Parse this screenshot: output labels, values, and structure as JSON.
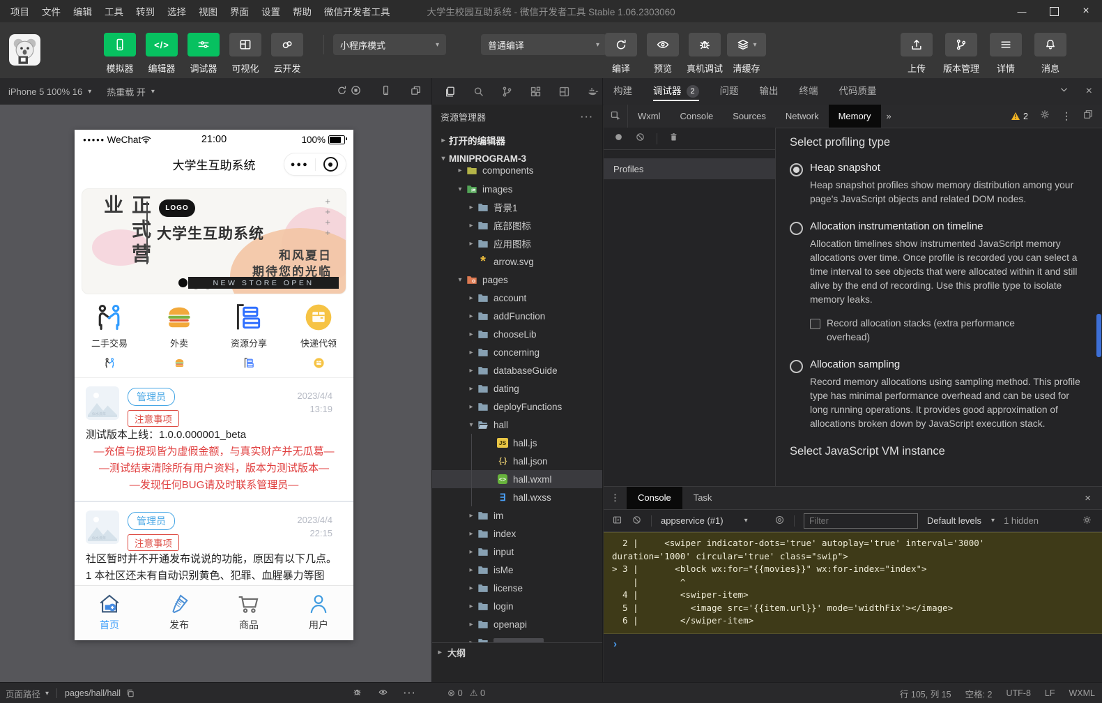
{
  "titlebar": {
    "menus": [
      "项目",
      "文件",
      "编辑",
      "工具",
      "转到",
      "选择",
      "视图",
      "界面",
      "设置",
      "帮助",
      "微信开发者工具"
    ],
    "title": "大学生校园互助系统 - 微信开发者工具 Stable 1.06.2303060"
  },
  "toolbar": {
    "modes": [
      {
        "label": "模拟器",
        "icon": "simulator",
        "active": true
      },
      {
        "label": "编辑器",
        "icon": "editor",
        "active": true
      },
      {
        "label": "调试器",
        "icon": "debug-sliders",
        "active": true
      },
      {
        "label": "可视化",
        "icon": "visual-layout",
        "active": false
      },
      {
        "label": "云开发",
        "icon": "cloud-dev",
        "active": false
      }
    ],
    "mode_select": "小程序模式",
    "compile_select": "普通编译",
    "compile_actions": [
      {
        "label": "编译",
        "icon": "compile-refresh"
      },
      {
        "label": "预览",
        "icon": "preview-eye"
      },
      {
        "label": "真机调试",
        "icon": "device-bug"
      },
      {
        "label": "清缓存",
        "icon": "cache-layers",
        "dropdown": true
      }
    ],
    "right_actions": [
      {
        "label": "上传",
        "icon": "upload"
      },
      {
        "label": "版本管理",
        "icon": "version-branch"
      },
      {
        "label": "详情",
        "icon": "details-list"
      },
      {
        "label": "消息",
        "icon": "message-bell"
      }
    ]
  },
  "simulator": {
    "device_select": "iPhone 5 100% 16",
    "hot_reload": "热重载 开",
    "status": {
      "carrier": "WeChat",
      "time": "21:00",
      "battery": "100%"
    },
    "nav_title": "大学生互助系统",
    "banner": {
      "vertical_title": "正式营业",
      "logo": "LOGO",
      "title": "大学生互助系统",
      "pluses": "+\n+\n+\n+",
      "subtitle1": "和风夏日",
      "subtitle2": "期待您的光临",
      "ribbon": "NEW STORE OPEN"
    },
    "grid": [
      {
        "label": "二手交易",
        "icon": "trade"
      },
      {
        "label": "外卖",
        "icon": "burger"
      },
      {
        "label": "资源分享",
        "icon": "books"
      },
      {
        "label": "快递代领",
        "icon": "parcel"
      }
    ],
    "cards": [
      {
        "badge1": "管理员",
        "badge2": "注意事项",
        "date": "2023/4/4",
        "time": "13:19",
        "lines": [
          {
            "t": "测试版本上线：1.0.0.000001_beta",
            "c": "d",
            "a": "l"
          },
          {
            "t": "—充值与提现皆为虚假金额，与真实财产并无瓜葛—",
            "c": "r",
            "a": "c"
          },
          {
            "t": "—测试结束清除所有用户资料，版本为测试版本—",
            "c": "r",
            "a": "c"
          },
          {
            "t": "—发现任何BUG请及时联系管理员—",
            "c": "r",
            "a": "c"
          }
        ]
      },
      {
        "badge1": "管理员",
        "badge2": "注意事项",
        "date": "2023/4/4",
        "time": "22:15",
        "lines": [
          {
            "t": "社区暂时并不开通发布说说的功能，原因有以下几点。",
            "c": "d",
            "a": "l"
          },
          {
            "t": "1 本社区还未有自动识别黄色、犯罪、血腥暴力等图",
            "c": "d",
            "a": "l"
          }
        ]
      }
    ],
    "tabbar": [
      {
        "label": "首页",
        "icon": "home",
        "active": true
      },
      {
        "label": "发布",
        "icon": "publish",
        "active": false
      },
      {
        "label": "商品",
        "icon": "goods",
        "active": false
      },
      {
        "label": "用户",
        "icon": "user",
        "active": false
      }
    ]
  },
  "explorer": {
    "header": "资源管理器",
    "tree": [
      {
        "label": "打开的编辑器",
        "lvl": 0,
        "arrow": "r",
        "icon": "none",
        "top": true
      },
      {
        "label": "MINIPROGRAM-3",
        "lvl": 0,
        "arrow": "d",
        "icon": "none",
        "top": true
      },
      {
        "label": "components",
        "lvl": 1,
        "arrow": "r",
        "icon": "comp",
        "clip": true
      },
      {
        "label": "images",
        "lvl": 1,
        "arrow": "d",
        "icon": "img"
      },
      {
        "label": "背景1",
        "lvl": 2,
        "arrow": "r",
        "icon": "folder"
      },
      {
        "label": "底部图标",
        "lvl": 2,
        "arrow": "r",
        "icon": "folder"
      },
      {
        "label": "应用图标",
        "lvl": 2,
        "arrow": "r",
        "icon": "folder"
      },
      {
        "label": "arrow.svg",
        "lvl": 2,
        "arrow": "n",
        "icon": "svgfile"
      },
      {
        "label": "pages",
        "lvl": 1,
        "arrow": "d",
        "icon": "pages"
      },
      {
        "label": "account",
        "lvl": 2,
        "arrow": "r",
        "icon": "folder"
      },
      {
        "label": "addFunction",
        "lvl": 2,
        "arrow": "r",
        "icon": "folder"
      },
      {
        "label": "chooseLib",
        "lvl": 2,
        "arrow": "r",
        "icon": "folder"
      },
      {
        "label": "concerning",
        "lvl": 2,
        "arrow": "r",
        "icon": "folder"
      },
      {
        "label": "databaseGuide",
        "lvl": 2,
        "arrow": "r",
        "icon": "folder"
      },
      {
        "label": "dating",
        "lvl": 2,
        "arrow": "r",
        "icon": "folder"
      },
      {
        "label": "deployFunctions",
        "lvl": 2,
        "arrow": "r",
        "icon": "folder"
      },
      {
        "label": "hall",
        "lvl": 2,
        "arrow": "d",
        "icon": "folderOpen"
      },
      {
        "label": "hall.js",
        "lvl": 3,
        "arrow": "n",
        "icon": "js",
        "guide": true
      },
      {
        "label": "hall.json",
        "lvl": 3,
        "arrow": "n",
        "icon": "json",
        "guide": true
      },
      {
        "label": "hall.wxml",
        "lvl": 3,
        "arrow": "n",
        "icon": "wxml",
        "guide": true,
        "selected": true
      },
      {
        "label": "hall.wxss",
        "lvl": 3,
        "arrow": "n",
        "icon": "wxss",
        "guide": true
      },
      {
        "label": "im",
        "lvl": 2,
        "arrow": "r",
        "icon": "folder"
      },
      {
        "label": "index",
        "lvl": 2,
        "arrow": "r",
        "icon": "folder"
      },
      {
        "label": "input",
        "lvl": 2,
        "arrow": "r",
        "icon": "folder"
      },
      {
        "label": "isMe",
        "lvl": 2,
        "arrow": "r",
        "icon": "folder"
      },
      {
        "label": "license",
        "lvl": 2,
        "arrow": "r",
        "icon": "folder"
      },
      {
        "label": "login",
        "lvl": 2,
        "arrow": "r",
        "icon": "folder"
      },
      {
        "label": "openapi",
        "lvl": 2,
        "arrow": "r",
        "icon": "folder"
      },
      {
        "label": "",
        "lvl": 2,
        "arrow": "r",
        "icon": "folder",
        "partial": true
      }
    ],
    "outline": "大纲",
    "problems": {
      "errors": "0",
      "warnings": "0"
    }
  },
  "panel": {
    "tabs": [
      {
        "label": "构建"
      },
      {
        "label": "调试器",
        "badge": "2",
        "active": true
      },
      {
        "label": "问题"
      },
      {
        "label": "输出"
      },
      {
        "label": "终端"
      },
      {
        "label": "代码质量"
      }
    ]
  },
  "devtools": {
    "tabs": [
      {
        "label": "Wxml"
      },
      {
        "label": "Console"
      },
      {
        "label": "Sources"
      },
      {
        "label": "Network"
      },
      {
        "label": "Memory",
        "active": true
      }
    ],
    "overflow": "»",
    "warning_count": "2",
    "profiles_header": "Profiles",
    "memory": {
      "heading": "Select profiling type",
      "options": [
        {
          "title": "Heap snapshot",
          "selected": true,
          "desc": "Heap snapshot profiles show memory distribution among your page's JavaScript objects and related DOM nodes."
        },
        {
          "title": "Allocation instrumentation on timeline",
          "selected": false,
          "desc": "Allocation timelines show instrumented JavaScript memory allocations over time. Once profile is recorded you can select a time interval to see objects that were allocated within it and still alive by the end of recording. Use this profile type to isolate memory leaks.",
          "checkbox": "Record allocation stacks (extra performance overhead)"
        },
        {
          "title": "Allocation sampling",
          "selected": false,
          "desc": "Record memory allocations using sampling method. This profile type has minimal performance overhead and can be used for long running operations. It provides good approximation of allocations broken down by JavaScript execution stack."
        }
      ],
      "vm_heading": "Select JavaScript VM instance"
    }
  },
  "console": {
    "tabs": [
      {
        "label": "Console",
        "active": true
      },
      {
        "label": "Task",
        "active": false
      }
    ],
    "context": "appservice (#1)",
    "filter_placeholder": "Filter",
    "levels": "Default levels",
    "hidden": "1 hidden",
    "lines": [
      "  2 |     <swiper indicator-dots='true' autoplay='true' interval='3000'",
      "duration='1000' circular='true' class=\"swip\">",
      "> 3 |       <block wx:for=\"{{movies}}\" wx:for-index=\"index\">",
      "    |        ^",
      "  4 |        <swiper-item>",
      "  5 |          <image src='{{item.url}}' mode='widthFix'></image>",
      "  6 |        </swiper-item>"
    ],
    "prompt": "›"
  },
  "statusbar": {
    "page_path_label": "页面路径",
    "page_path": "pages/hall/hall",
    "errors": "0",
    "warnings": "0",
    "right": [
      "行 105, 列 15",
      "空格: 2",
      "UTF-8",
      "LF",
      "WXML"
    ]
  }
}
